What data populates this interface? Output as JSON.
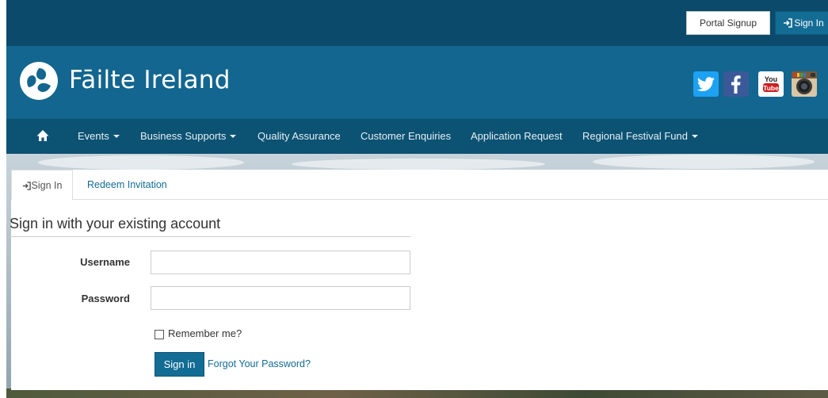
{
  "topbar": {
    "portal_signup_label": "Portal Signup",
    "signin_label": "Sign In",
    "signin_icon": "sign-in-icon"
  },
  "brand": {
    "logo_text": "Fāilte Ireland",
    "logo_icon": "failte-ireland-logo-icon",
    "social": [
      {
        "name": "twitter-icon",
        "glyph": "t"
      },
      {
        "name": "facebook-icon",
        "glyph": "f"
      },
      {
        "name": "youtube-icon",
        "text_top": "You",
        "text_bottom": "Tube"
      },
      {
        "name": "instagram-icon"
      }
    ]
  },
  "nav": {
    "home_icon": "home-icon",
    "items": [
      {
        "label": "Events",
        "dropdown": true
      },
      {
        "label": "Business Supports",
        "dropdown": true
      },
      {
        "label": "Quality Assurance",
        "dropdown": false
      },
      {
        "label": "Customer Enquiries",
        "dropdown": false
      },
      {
        "label": "Application Request",
        "dropdown": false
      },
      {
        "label": "Regional Festival Fund",
        "dropdown": true
      }
    ]
  },
  "tabs": {
    "signin": "Sign In",
    "redeem": "Redeem Invitation"
  },
  "form": {
    "heading": "Sign in with your existing account",
    "username_label": "Username",
    "username_value": "",
    "password_label": "Password",
    "password_value": "",
    "remember_label": "Remember me?",
    "remember_checked": false,
    "submit_label": "Sign in",
    "forgot_label": "Forgot Your Password?"
  },
  "colors": {
    "topbar": "#0b4a6b",
    "brand": "#12668f",
    "nav": "#0c5273",
    "accent": "#136c94"
  }
}
